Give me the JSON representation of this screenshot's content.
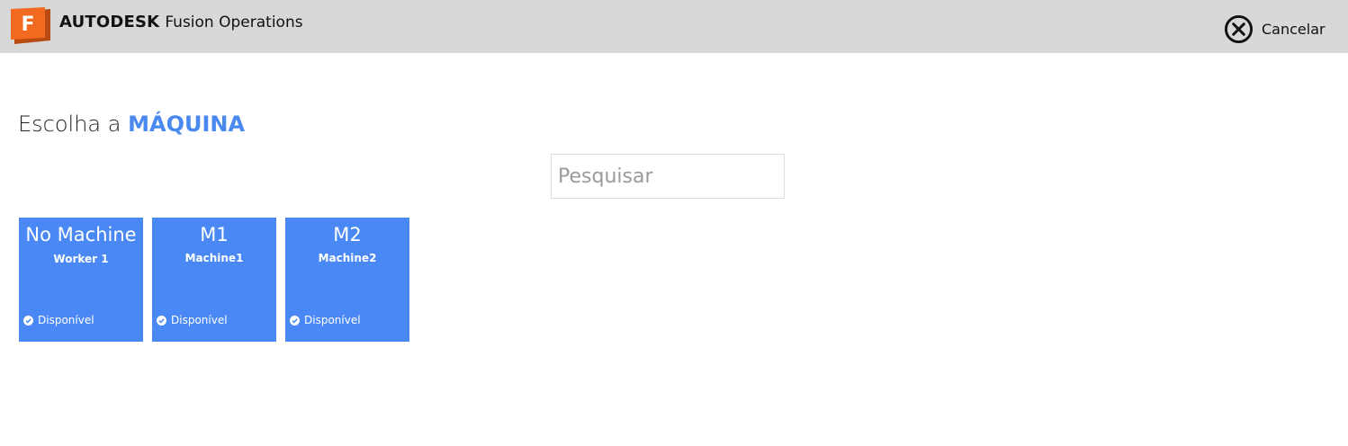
{
  "header": {
    "brand_bold": "AUTODESK",
    "brand_light": "Fusion Operations",
    "logo_letter": "F",
    "cancel_label": "Cancelar"
  },
  "page": {
    "title_prefix": "Escolha a",
    "title_accent": "MÁQUINA"
  },
  "search": {
    "placeholder": "Pesquisar",
    "value": ""
  },
  "colors": {
    "topbar": "#d8d8d8",
    "accent": "#4a89f0",
    "tile": "#4a89f5",
    "logo_orange": "#f26a1f"
  },
  "machines": [
    {
      "name": "No Machine",
      "worker": "Worker 1",
      "status": "Disponível",
      "status_icon": "check-circle-icon"
    },
    {
      "name": "M1",
      "worker": "Machine1",
      "status": "Disponível",
      "status_icon": "check-circle-icon"
    },
    {
      "name": "M2",
      "worker": "Machine2",
      "status": "Disponível",
      "status_icon": "check-circle-icon"
    }
  ]
}
